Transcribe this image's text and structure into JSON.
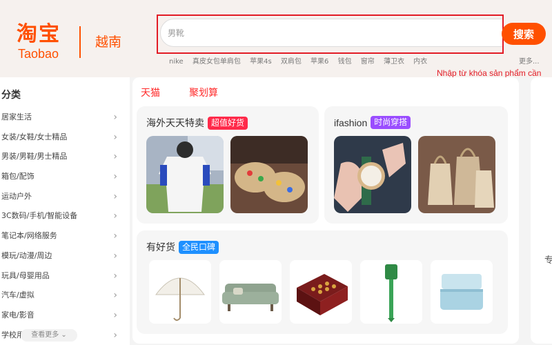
{
  "header": {
    "logo_cn": "淘宝",
    "logo_en": "Taobao",
    "region": "越南",
    "search": {
      "placeholder": "男靴",
      "button_label": "搜索"
    },
    "hot_words": [
      "nike",
      "真皮女包单肩包",
      "苹果4s",
      "双肩包",
      "苹果6",
      "钱包",
      "窗帘",
      "薄卫衣",
      "内衣"
    ],
    "more_label": "更多...",
    "annotation": "Nhập từ khóa sản phẩm cần"
  },
  "sidebar": {
    "title": "分类",
    "items": [
      "居家生活",
      "女装/女鞋/女士精品",
      "男装/男鞋/男士精品",
      "箱包/配饰",
      "运动户外",
      "3C数码/手机/智能设备",
      "笔记本/网络服务",
      "模玩/动漫/周边",
      "玩具/母婴用品",
      "汽车/虚拟",
      "家电/影音",
      "学校用品"
    ],
    "see_more": "查看更多"
  },
  "main": {
    "top_tabs": [
      "天猫",
      "聚划算"
    ],
    "cards": {
      "overseas": {
        "title": "海外天天特卖",
        "badge": "超值好货"
      },
      "ifashion": {
        "title": "ifashion",
        "badge": "时尚穿搭"
      },
      "goods": {
        "title": "有好货",
        "badge": "全民口碑"
      }
    },
    "right_partial": "专"
  },
  "colors": {
    "brand": "#ff5000",
    "highlight": "#e21b25",
    "badge_red": "#ff2a4a",
    "badge_purple": "#9a4dff",
    "badge_blue": "#1e90ff"
  }
}
